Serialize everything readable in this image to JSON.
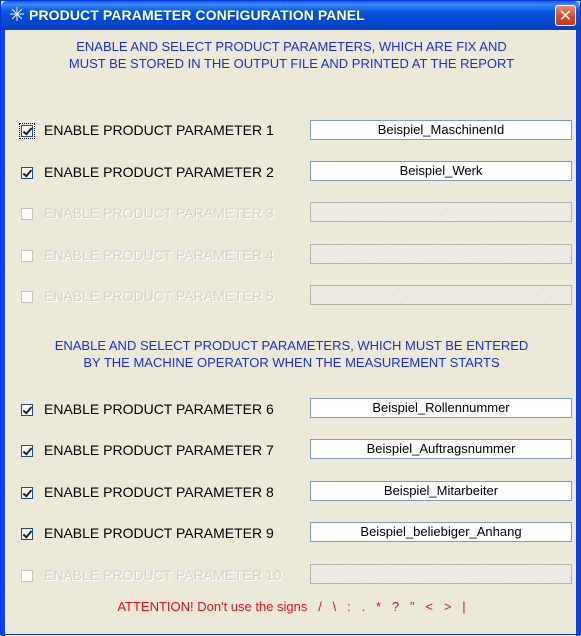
{
  "window": {
    "title": "PRODUCT PARAMETER CONFIGURATION PANEL",
    "close_glyph": "✕",
    "title_icon": "✳"
  },
  "section1": {
    "heading_line1": "ENABLE AND SELECT PRODUCT PARAMETERS, WHICH ARE FIX AND",
    "heading_line2": "MUST BE STORED IN THE OUTPUT FILE AND PRINTED AT THE REPORT"
  },
  "section2": {
    "heading_line1": "ENABLE AND SELECT PRODUCT PARAMETERS, WHICH MUST BE ENTERED",
    "heading_line2": "BY THE MACHINE OPERATOR WHEN THE MEASUREMENT STARTS"
  },
  "parameters": [
    {
      "label": "ENABLE PRODUCT PARAMETER 1",
      "checked": true,
      "enabled": true,
      "value": "Beispiel_MaschinenId"
    },
    {
      "label": "ENABLE PRODUCT PARAMETER 2",
      "checked": true,
      "enabled": true,
      "value": "Beispiel_Werk"
    },
    {
      "label": "ENABLE PRODUCT PARAMETER 3",
      "checked": false,
      "enabled": false,
      "value": ""
    },
    {
      "label": "ENABLE PRODUCT PARAMETER 4",
      "checked": false,
      "enabled": false,
      "value": ""
    },
    {
      "label": "ENABLE PRODUCT PARAMETER 5",
      "checked": false,
      "enabled": false,
      "value": ""
    },
    {
      "label": "ENABLE PRODUCT PARAMETER 6",
      "checked": true,
      "enabled": true,
      "value": "Beispiel_Rollennummer"
    },
    {
      "label": "ENABLE PRODUCT PARAMETER 7",
      "checked": true,
      "enabled": true,
      "value": "Beispiel_Auftragsnummer"
    },
    {
      "label": "ENABLE PRODUCT PARAMETER 8",
      "checked": true,
      "enabled": true,
      "value": "Beispiel_Mitarbeiter"
    },
    {
      "label": "ENABLE PRODUCT PARAMETER 9",
      "checked": true,
      "enabled": true,
      "value": "Beispiel_beliebiger_Anhang"
    },
    {
      "label": "ENABLE PRODUCT PARAMETER 10",
      "checked": false,
      "enabled": false,
      "value": ""
    }
  ],
  "attention": "ATTENTION! Don't use the signs   /   \\   :   .   *   ?   \"   <   >   |"
}
